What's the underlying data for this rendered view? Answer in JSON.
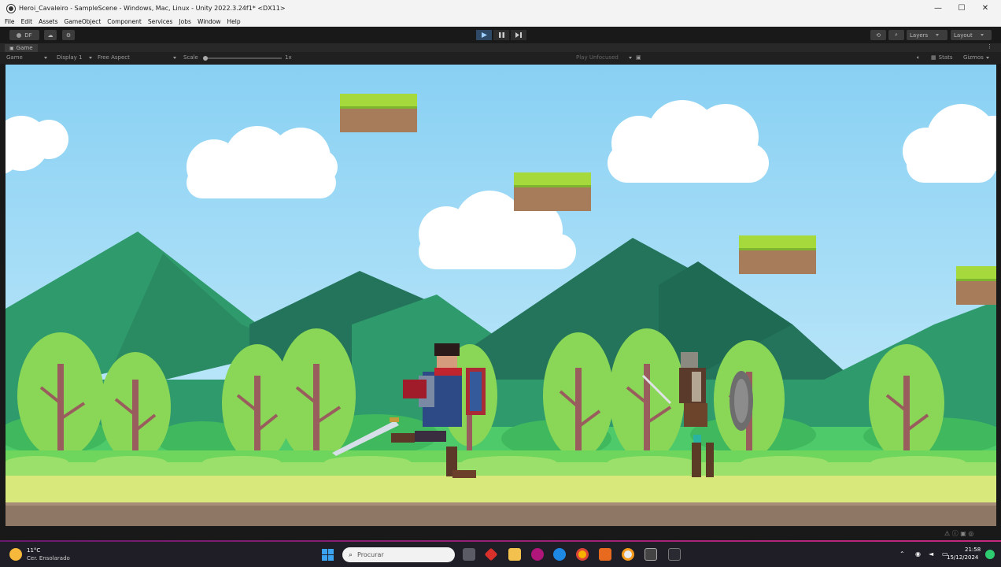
{
  "window": {
    "title": "Heroi_Cavaleiro - SampleScene - Windows, Mac, Linux - Unity 2022.3.24f1* <DX11>",
    "minimize": "—",
    "maximize": "☐",
    "close": "✕"
  },
  "menu": [
    "File",
    "Edit",
    "Assets",
    "GameObject",
    "Component",
    "Services",
    "Jobs",
    "Window",
    "Help"
  ],
  "toolbar": {
    "account": "DF",
    "layers_label": "Layers",
    "layout_label": "Layout"
  },
  "game_tab": {
    "label": "Game",
    "view_mode": "Game",
    "display": "Display 1",
    "aspect": "Free Aspect",
    "scale_label": "Scale",
    "scale_value": "1x",
    "play_mode": "Play Unfocused",
    "stats": "Stats",
    "gizmos": "Gizmos"
  },
  "taskbar": {
    "weather_temp": "11°C",
    "weather_desc": "Cer. Ensolarado",
    "search_placeholder": "Procurar",
    "time": "21:58",
    "date": "15/12/2024"
  },
  "colors": {
    "sky_top": "#8fd3f4",
    "sky_bottom": "#c9ecfb",
    "mountain_dark": "#23745a",
    "mountain_mid": "#2f9a6c",
    "grass": "#8ee05e",
    "ground": "#d8e87a",
    "dirt": "#8f7766",
    "platform_grass": "#a6d93b",
    "platform_dirt": "#a77c5b"
  },
  "icons": {
    "play": "play-icon",
    "pause": "pause-icon",
    "step": "step-icon"
  }
}
